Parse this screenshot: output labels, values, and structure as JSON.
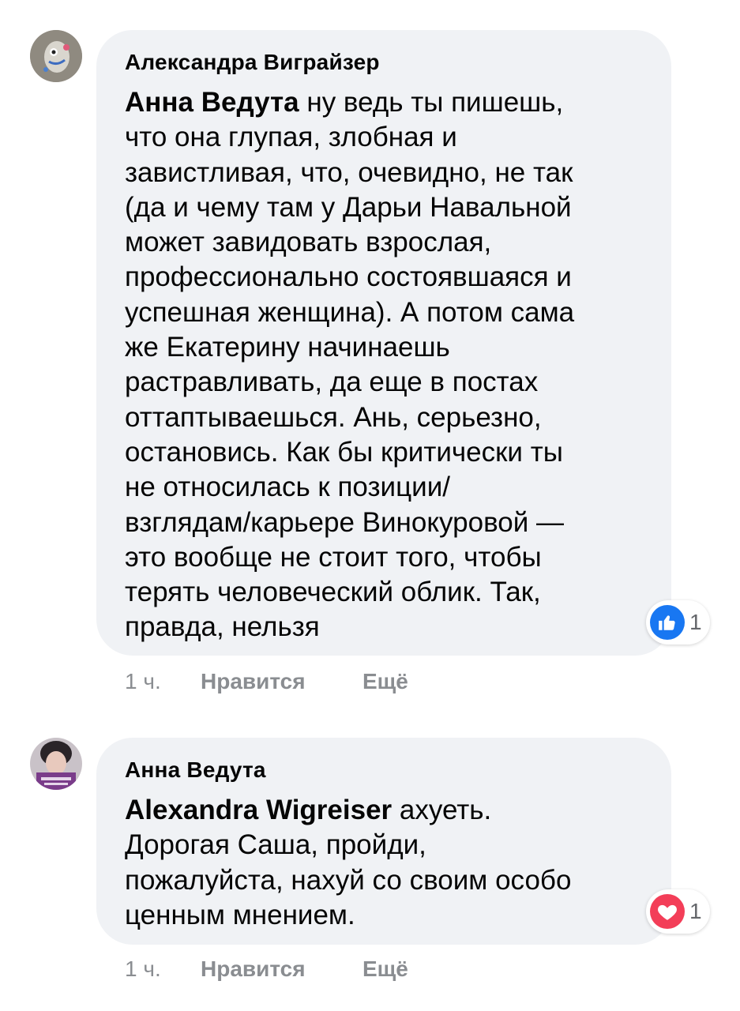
{
  "comments": [
    {
      "author": "Александра Виграйзер",
      "mention": "Анна Ведута",
      "text_lines": [
        " ну ведь ты пишешь,",
        "что она глупая, злобная и",
        "завистливая, что, очевидно, не так",
        "(да и чему там у Дарьи Навальной",
        "может завидовать взрослая,",
        "профессионально состоявшаяся и",
        "успешная женщина). А потом сама",
        "же Екатерину начинаешь",
        "растравливать, да еще в постах",
        "оттаптываешься. Ань, серьезно,",
        "остановись. Как бы критически ты",
        "не относилась к позиции/",
        "взглядам/карьере Винокуровой —",
        "это вообще не стоит того, чтобы",
        "терять человеческий облик. Так,",
        "правда, нельзя"
      ],
      "reaction": {
        "icon": "like-icon",
        "count": "1",
        "color": "#1877f2"
      },
      "time": "1 ч.",
      "like_label": "Нравится",
      "more_label": "Ещё"
    },
    {
      "author": "Анна Ведута",
      "mention": "Alexandra Wigreiser",
      "text_lines": [
        " ахуеть.",
        "Дорогая Саша, пройди,",
        "пожалуйста, нахуй со своим особо",
        "ценным мнением."
      ],
      "reaction": {
        "icon": "love-icon",
        "count": "1",
        "color": "#f33e58"
      },
      "time": "1 ч.",
      "like_label": "Нравится",
      "more_label": "Ещё"
    }
  ]
}
